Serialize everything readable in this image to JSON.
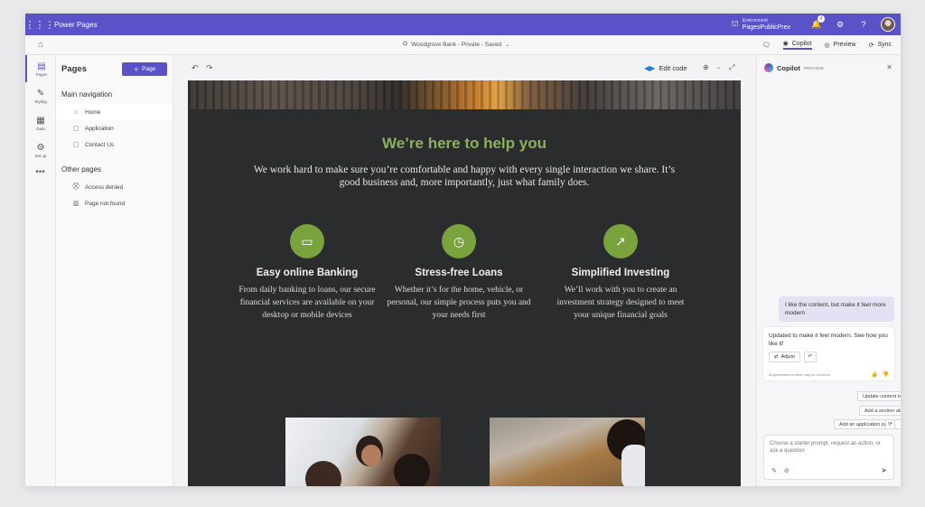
{
  "app": {
    "title": "Power Pages",
    "environment_label": "Environment",
    "environment_name": "PagesPublicPrev",
    "notification_count": "4",
    "icons": [
      "waffle-icon",
      "environment-icon",
      "bell-icon",
      "gear-icon",
      "help-icon"
    ]
  },
  "command_bar": {
    "site_name": "Woodgrove Bank - Private - Saved",
    "copilot_label": "Copilot",
    "preview_label": "Preview",
    "sync_label": "Sync"
  },
  "rail": {
    "items": [
      {
        "label": "Pages",
        "icon": "pages-icon"
      },
      {
        "label": "Styling",
        "icon": "styling-icon"
      },
      {
        "label": "Data",
        "icon": "data-icon"
      },
      {
        "label": "Set up",
        "icon": "setup-icon"
      }
    ],
    "more": "•••"
  },
  "pages_panel": {
    "title": "Pages",
    "add_label": "Page",
    "main_nav_title": "Main navigation",
    "main_items": [
      "Home",
      "Application",
      "Contact Us"
    ],
    "other_title": "Other pages",
    "other_items": [
      "Access denied",
      "Page not found"
    ]
  },
  "canvas": {
    "edit_code_label": "Edit code"
  },
  "site": {
    "title": "We’re here to help you",
    "intro": "We work hard to make sure you’re comfortable and happy with every single interaction we share. It’s good business and, more importantly, just what family does.",
    "features": [
      {
        "title": "Easy online Banking",
        "desc": "From daily banking to loans, our secure financial services are available on your desktop or mobile devices",
        "icon": "laptop-icon"
      },
      {
        "title": "Stress-free Loans",
        "desc": "Whether it’s for the home, vehicle, or personal, our simple process puts you and your needs first",
        "icon": "clock-24-icon"
      },
      {
        "title": "Simplified Investing",
        "desc": "We’ll work with you to create an investment strategy designed to meet your unique financial goals",
        "icon": "chart-up-icon"
      }
    ]
  },
  "copilot": {
    "title": "Copilot",
    "badge": "PREVIEW",
    "user_message": "I like the content, but make it feel more modern",
    "bot_message": "Updated to make it feel modern. See how you like it!",
    "adjust_label": "Adjust",
    "disclaimer": "AI-generated content may be incorrect",
    "suggestions": [
      "Update content tone...",
      "Add a section about...",
      "Add an application page..."
    ],
    "input_placeholder": "Choose a starter prompt, request an action, or ask a question"
  },
  "colors": {
    "brand": "#5b52c7",
    "site_accent": "#8db05a",
    "icon_circle": "#7aa23d",
    "site_bg": "#2b2c2e"
  }
}
